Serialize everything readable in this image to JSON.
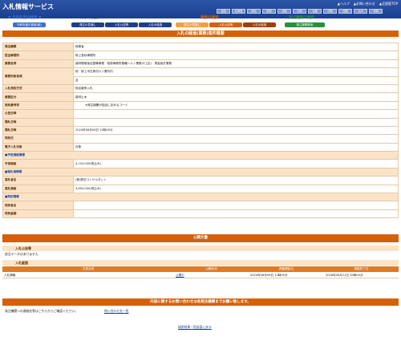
{
  "header": {
    "title": "入札情報サービス",
    "util": [
      "▲ヘルプ",
      "▲お問い合わせ",
      "▲全国版TOP"
    ],
    "regions": [
      "全国",
      "北海道",
      "東北",
      "関東",
      "北陸",
      "中部",
      "近畿",
      "中国",
      "四国",
      "九州",
      "沖縄"
    ]
  },
  "nav": {
    "group1": {
      "title": "▼ 令和年度の検索 ▼",
      "buttons": [
        "令和年度の検索(総)"
      ]
    },
    "group2": {
      "title": "工事の検索",
      "buttons": [
        "発注の見通し",
        "入札公告等",
        "入札の経過"
      ]
    },
    "group3": {
      "title": "業務の検索",
      "buttons": [
        "発注の見通し",
        "入札公告等",
        "入札の経過"
      ]
    },
    "group4": {
      "title": "発注機関の検索",
      "buttons": [
        "発注機関検索"
      ]
    }
  },
  "page": {
    "title": "入札の経過(業務)案件概要",
    "subtitle": "入札の経過(業務)案件概要"
  },
  "fields": [
    {
      "label": "発注機関",
      "value": "総務省"
    },
    {
      "label": "担当事務所",
      "value": "那上島砂事務所"
    },
    {
      "label": "業務名称",
      "value": "森林環境保全整備事業　桧原事務所管轄～六ノ業務(3工区)　測量設計業務"
    },
    {
      "label": "業務対象地域",
      "value": "他　那上市白鳥村六ノ業所内",
      "value2": "芸"
    },
    {
      "label": "入札契約方式",
      "value": "指名競争入札"
    },
    {
      "label": "業務区分",
      "value": "森林土木"
    },
    {
      "label": "契約番号等",
      "value": "※発注機関が独自に定めるコード"
    },
    {
      "label": "公告日時",
      "value": ""
    },
    {
      "label": "開札日時",
      "value": ""
    },
    {
      "label": "開札日時",
      "value": "2024年06月06日 10時00分"
    },
    {
      "label": "契約日",
      "value": ""
    },
    {
      "label": "電子入札対象",
      "value": "対象"
    }
  ],
  "section_budget": "■予定価格情報",
  "budget": [
    {
      "label": "予定価格",
      "value": "4,103,000(税込み)"
    }
  ],
  "section_winner": "■落札者情報",
  "winner": [
    {
      "label": "落札者名",
      "value": "(株)那旧コンサルタント"
    },
    {
      "label": "落札価格",
      "value": "3,894,000(税込み)"
    }
  ],
  "section_contract": "■契約情報",
  "contract": [
    {
      "label": "契約者名",
      "value": ""
    },
    {
      "label": "契約金額",
      "value": ""
    }
  ],
  "docs": {
    "title": "公開文書",
    "sub1": "入札公告等",
    "sub1_note": "該当データはありません",
    "sub2": "入札経過",
    "columns": [
      "文書名称",
      "公開状況",
      "掲載開始日",
      "掲載終了日"
    ],
    "rows": [
      {
        "name": "入札情報",
        "status": "公開中",
        "start": "2024年06月06日 10時00分",
        "end": "2026年06月11日 00時00分"
      }
    ]
  },
  "contact": {
    "band": "内容に関するお問い合わせは各発注機関までお願い致します。",
    "text": "発注機関への連絡先等はこちらからご確認ください。",
    "link": "問い合わせ先一覧"
  },
  "footer_link": "検索結果一覧画面に戻る",
  "colors": {
    "header": "#1a3f8f",
    "accent": "#d4600a",
    "label_bg": "#fbe3c8"
  }
}
